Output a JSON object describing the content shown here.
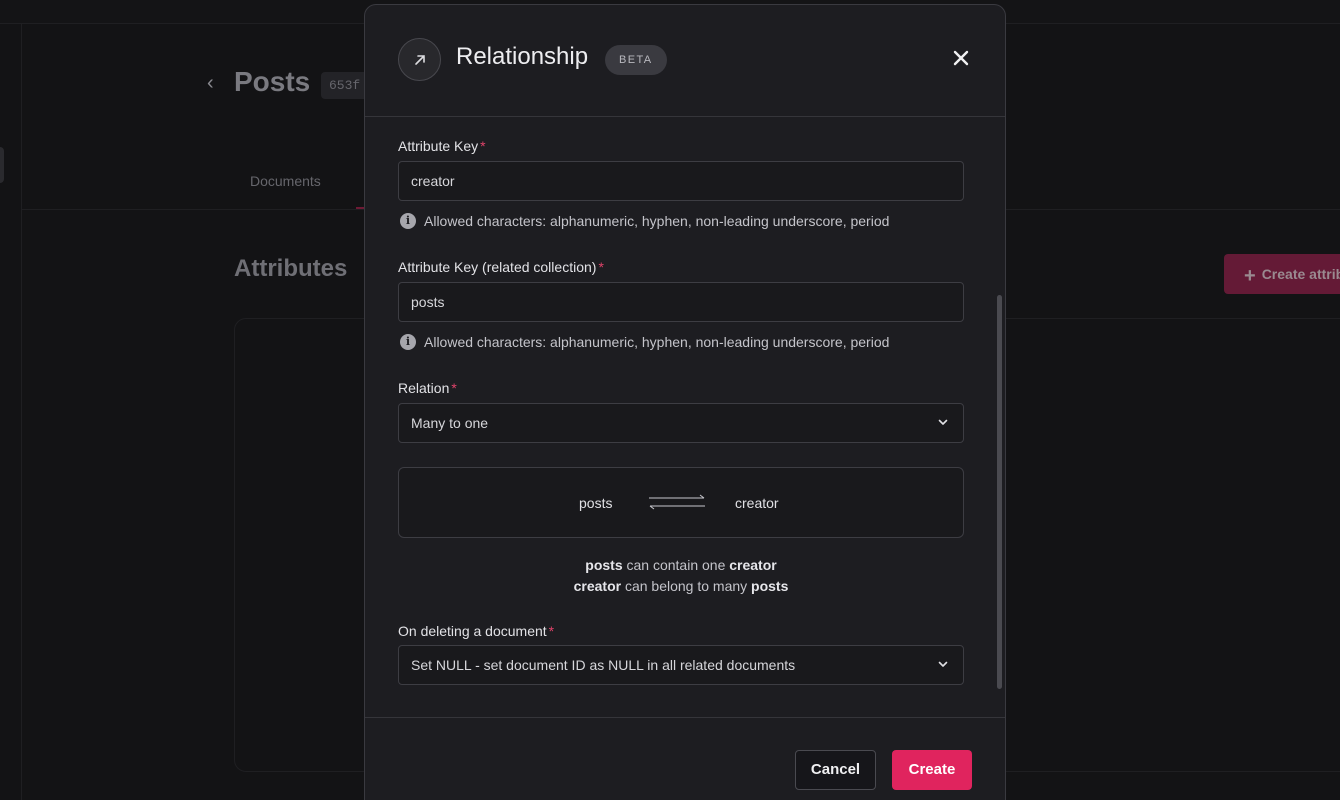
{
  "background": {
    "back_icon": "chevron-left-icon",
    "page_title": "Posts",
    "collection_id": "653f",
    "tabs": [
      "Documents"
    ],
    "section_title": "Attributes",
    "create_button": "Create attribute"
  },
  "modal": {
    "header_icon": "arrow-up-right-icon",
    "title": "Relationship",
    "badge": "BETA",
    "close_icon": "close-icon",
    "fields": {
      "attribute_key": {
        "label": "Attribute Key",
        "value": "creator",
        "helper": "Allowed characters: alphanumeric, hyphen, non-leading underscore, period"
      },
      "related_key": {
        "label": "Attribute Key (related collection)",
        "value": "posts",
        "helper": "Allowed characters: alphanumeric, hyphen, non-leading underscore, period"
      },
      "relation": {
        "label": "Relation",
        "value": "Many to one"
      },
      "on_delete": {
        "label": "On deleting a document",
        "value": "Set NULL - set document ID as NULL in all related documents"
      }
    },
    "diagram": {
      "left": "posts",
      "right": "creator"
    },
    "description": {
      "line1": {
        "a": "posts",
        "mid": "can contain one",
        "b": "creator"
      },
      "line2": {
        "a": "creator",
        "mid": "can belong to many",
        "b": "posts"
      }
    },
    "footer": {
      "cancel": "Cancel",
      "create": "Create"
    }
  },
  "colors": {
    "accent": "#e0245e",
    "required": "#e0436a",
    "modal_bg": "#1d1d21",
    "page_bg": "#131315"
  }
}
